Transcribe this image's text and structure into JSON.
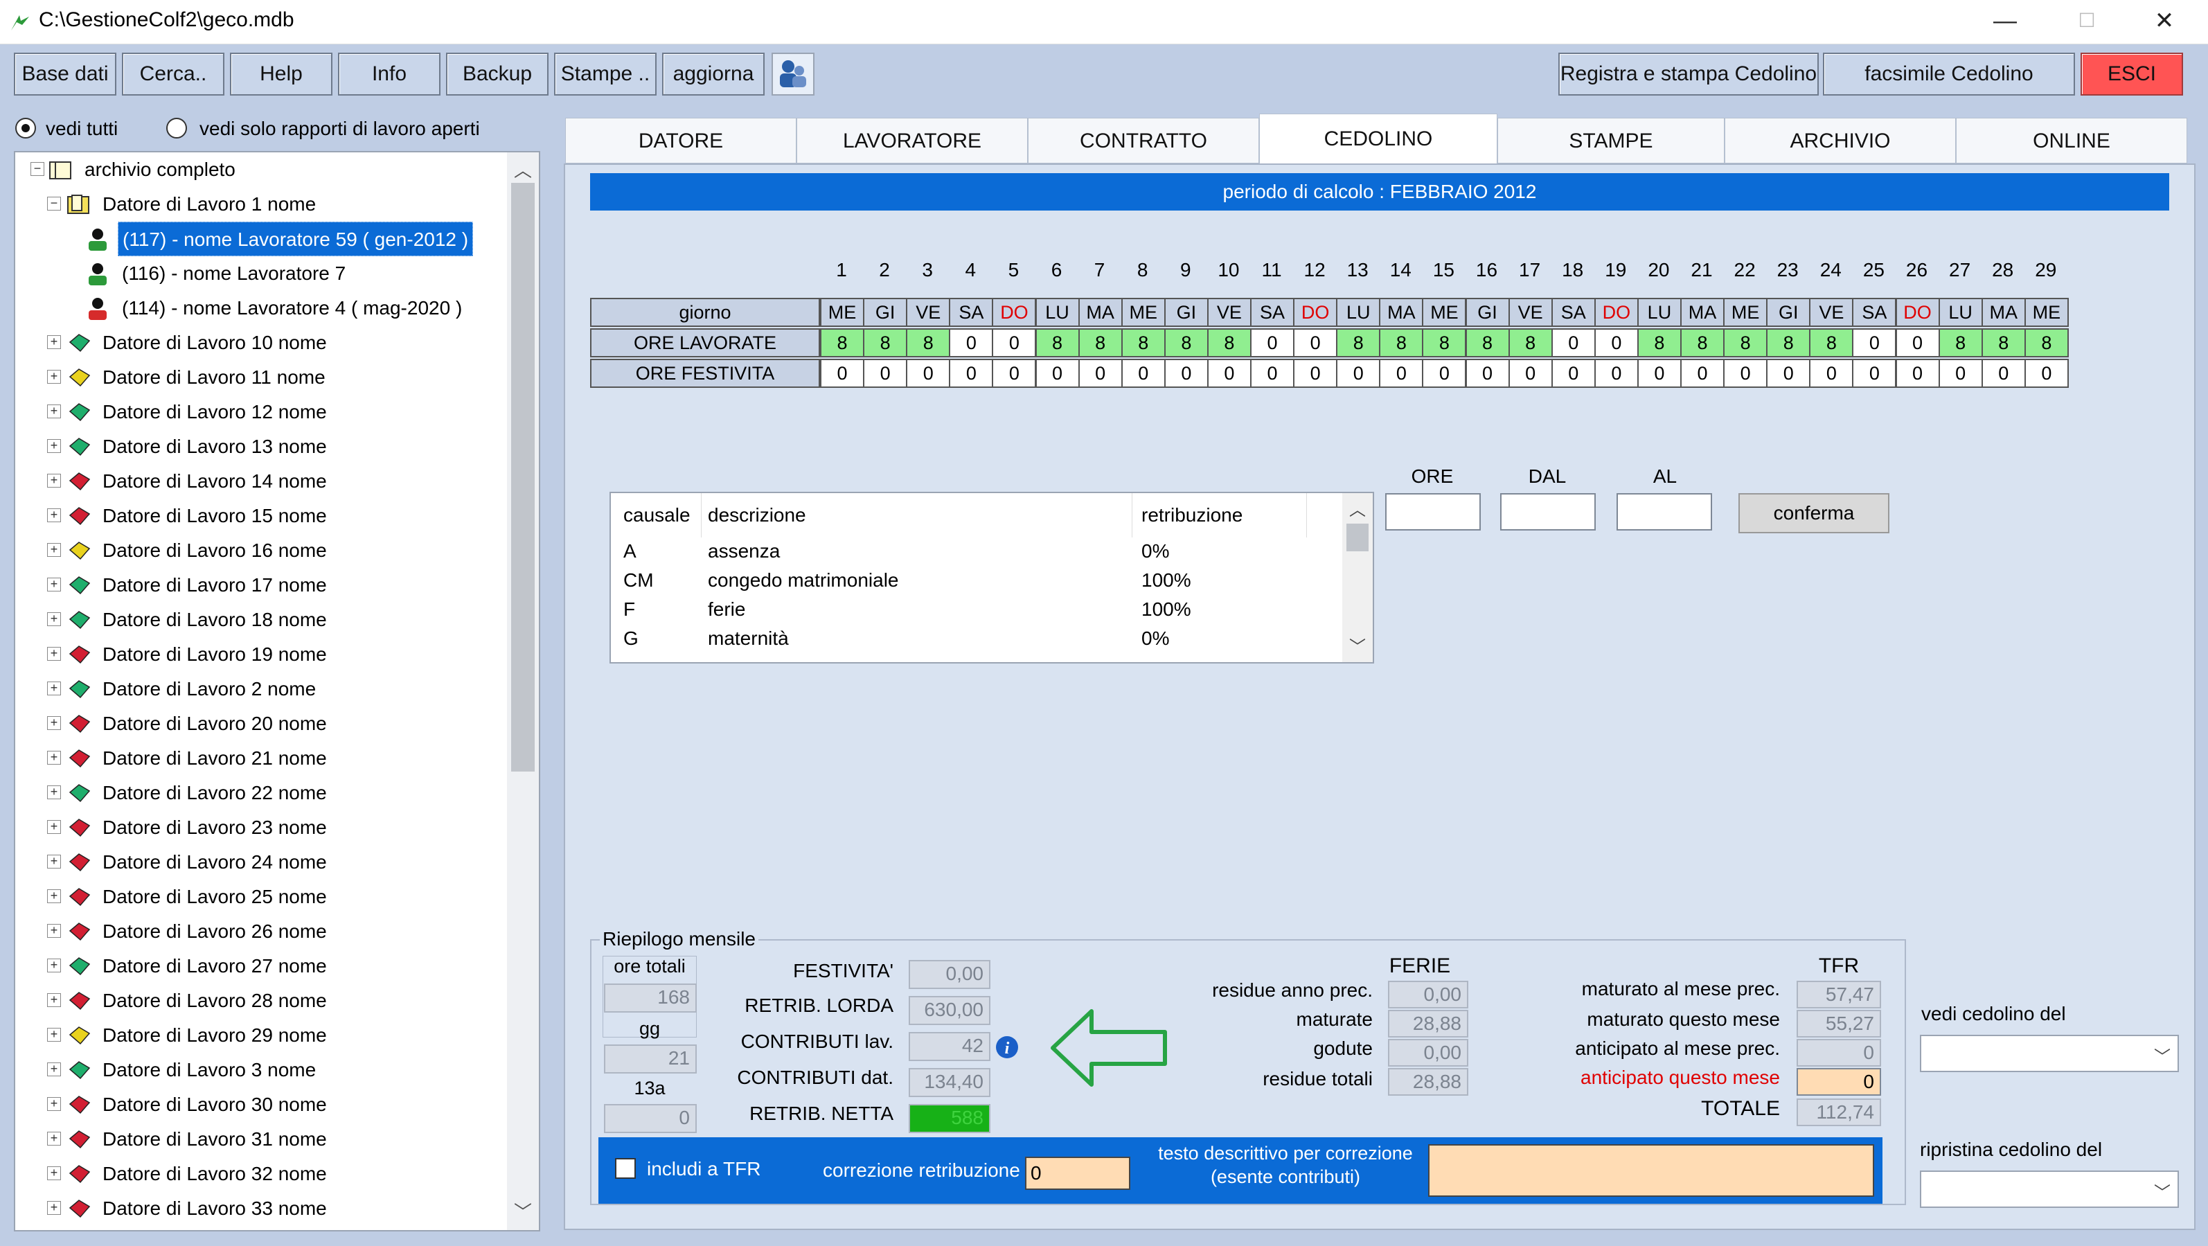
{
  "window": {
    "title": "C:\\GestioneColf2\\geco.mdb",
    "minimize": "—",
    "maximize": "☐",
    "close": "✕"
  },
  "toolbar": {
    "buttons": [
      "Base dati",
      "Cerca..",
      "Help",
      "Info",
      "Backup",
      "Stampe ..",
      "aggiorna"
    ],
    "right_buttons": [
      "Registra e stampa Cedolino",
      "facsimile Cedolino",
      "ESCI"
    ]
  },
  "filters": {
    "vedi_tutti": "vedi tutti",
    "vedi_aperti": "vedi solo rapporti di lavoro aperti"
  },
  "tree": {
    "root": "archivio completo",
    "first_employer": "Datore di Lavoro 1 nome",
    "workers": [
      "(117) - nome Lavoratore 59 ( gen-2012 )",
      "(116) - nome Lavoratore 7",
      "(114) - nome Lavoratore 4 ( mag-2020 )"
    ],
    "employers": [
      "Datore di Lavoro 10 nome",
      "Datore di Lavoro 11 nome",
      "Datore di Lavoro 12 nome",
      "Datore di Lavoro 13 nome",
      "Datore di Lavoro 14 nome",
      "Datore di Lavoro 15 nome",
      "Datore di Lavoro 16 nome",
      "Datore di Lavoro 17 nome",
      "Datore di Lavoro 18 nome",
      "Datore di Lavoro 19 nome",
      "Datore di Lavoro 2 nome",
      "Datore di Lavoro 20 nome",
      "Datore di Lavoro 21 nome",
      "Datore di Lavoro 22 nome",
      "Datore di Lavoro 23 nome",
      "Datore di Lavoro 24 nome",
      "Datore di Lavoro 25 nome",
      "Datore di Lavoro 26 nome",
      "Datore di Lavoro 27 nome",
      "Datore di Lavoro 28 nome",
      "Datore di Lavoro 29 nome",
      "Datore di Lavoro 3 nome",
      "Datore di Lavoro 30 nome",
      "Datore di Lavoro 31 nome",
      "Datore di Lavoro 32 nome",
      "Datore di Lavoro 33 nome"
    ],
    "employer_colors": [
      "green",
      "yellow",
      "green",
      "green",
      "red",
      "red",
      "yellow",
      "green",
      "green",
      "red",
      "green",
      "red",
      "red",
      "green",
      "red",
      "red",
      "red",
      "red",
      "green",
      "red",
      "yellow",
      "green",
      "red",
      "red",
      "red",
      "red"
    ]
  },
  "tabs": [
    "DATORE",
    "LAVORATORE",
    "CONTRATTO",
    "CEDOLINO",
    "STAMPE",
    "ARCHIVIO",
    "ONLINE"
  ],
  "active_tab": "CEDOLINO",
  "period": "periodo di calcolo : FEBBRAIO 2012",
  "calendar": {
    "row_labels": [
      "giorno",
      "ORE LAVORATE",
      "ORE FESTIVITA"
    ],
    "days": [
      "ME",
      "GI",
      "VE",
      "SA",
      "DO",
      "LU",
      "MA",
      "ME",
      "GI",
      "VE",
      "SA",
      "DO",
      "LU",
      "MA",
      "ME",
      "GI",
      "VE",
      "SA",
      "DO",
      "LU",
      "MA",
      "ME",
      "GI",
      "VE",
      "SA",
      "DO",
      "LU",
      "MA",
      "ME"
    ],
    "ore_lavorate": [
      8,
      8,
      8,
      0,
      0,
      8,
      8,
      8,
      8,
      8,
      0,
      0,
      8,
      8,
      8,
      8,
      8,
      0,
      0,
      8,
      8,
      8,
      8,
      8,
      0,
      0,
      8,
      8,
      8
    ],
    "ore_festivita": [
      0,
      0,
      0,
      0,
      0,
      0,
      0,
      0,
      0,
      0,
      0,
      0,
      0,
      0,
      0,
      0,
      0,
      0,
      0,
      0,
      0,
      0,
      0,
      0,
      0,
      0,
      0,
      0,
      0
    ],
    "sunday_color": "#e00000",
    "worked_color": "#90ee90"
  },
  "causale": {
    "headers": [
      "causale",
      "descrizione",
      "retribuzione"
    ],
    "rows": [
      {
        "code": "A",
        "desc": "assenza",
        "retr": "0%"
      },
      {
        "code": "CM",
        "desc": "congedo matrimoniale",
        "retr": "100%"
      },
      {
        "code": "F",
        "desc": "ferie",
        "retr": "100%"
      },
      {
        "code": "G",
        "desc": "maternità",
        "retr": "0%"
      }
    ]
  },
  "entry": {
    "ore_label": "ORE",
    "dal_label": "DAL",
    "al_label": "AL",
    "confirm": "conferma"
  },
  "riepilogo": {
    "title": "Riepilogo mensile",
    "ore_totali_label": "ore totali",
    "ore_totali": "168",
    "gg_label": "gg",
    "gg": "21",
    "tredicesima_label": "13a",
    "tredicesima": "0",
    "festivita_label": "FESTIVITA'",
    "festivita": "0,00",
    "lorda_label": "RETRIB. LORDA",
    "lorda": "630,00",
    "contrib_lav_label": "CONTRIBUTI lav.",
    "contrib_lav": "42",
    "contrib_dat_label": "CONTRIBUTI dat.",
    "contrib_dat": "134,40",
    "netta_label": "RETRIB. NETTA",
    "netta": "588",
    "ferie_title": "FERIE",
    "ferie_labels": [
      "residue anno prec.",
      "maturate",
      "godute",
      "residue totali"
    ],
    "ferie_values": [
      "0,00",
      "28,88",
      "0,00",
      "28,88"
    ],
    "tfr_title": "TFR",
    "tfr_labels": [
      "maturato al mese prec.",
      "maturato questo mese",
      "anticipato al mese prec.",
      "anticipato questo mese",
      "TOTALE"
    ],
    "tfr_values": [
      "57,47",
      "55,27",
      "0",
      "0",
      "112,74"
    ],
    "includi_tfr": "includi a TFR",
    "correzione_label": "correzione retribuzione",
    "correzione_value": "0",
    "testo_label_1": "testo descrittivo per correzione",
    "testo_label_2": "(esente contributi)"
  },
  "side": {
    "vedi_cedolino": "vedi cedolino del",
    "ripristina_cedolino": "ripristina  cedolino del"
  }
}
